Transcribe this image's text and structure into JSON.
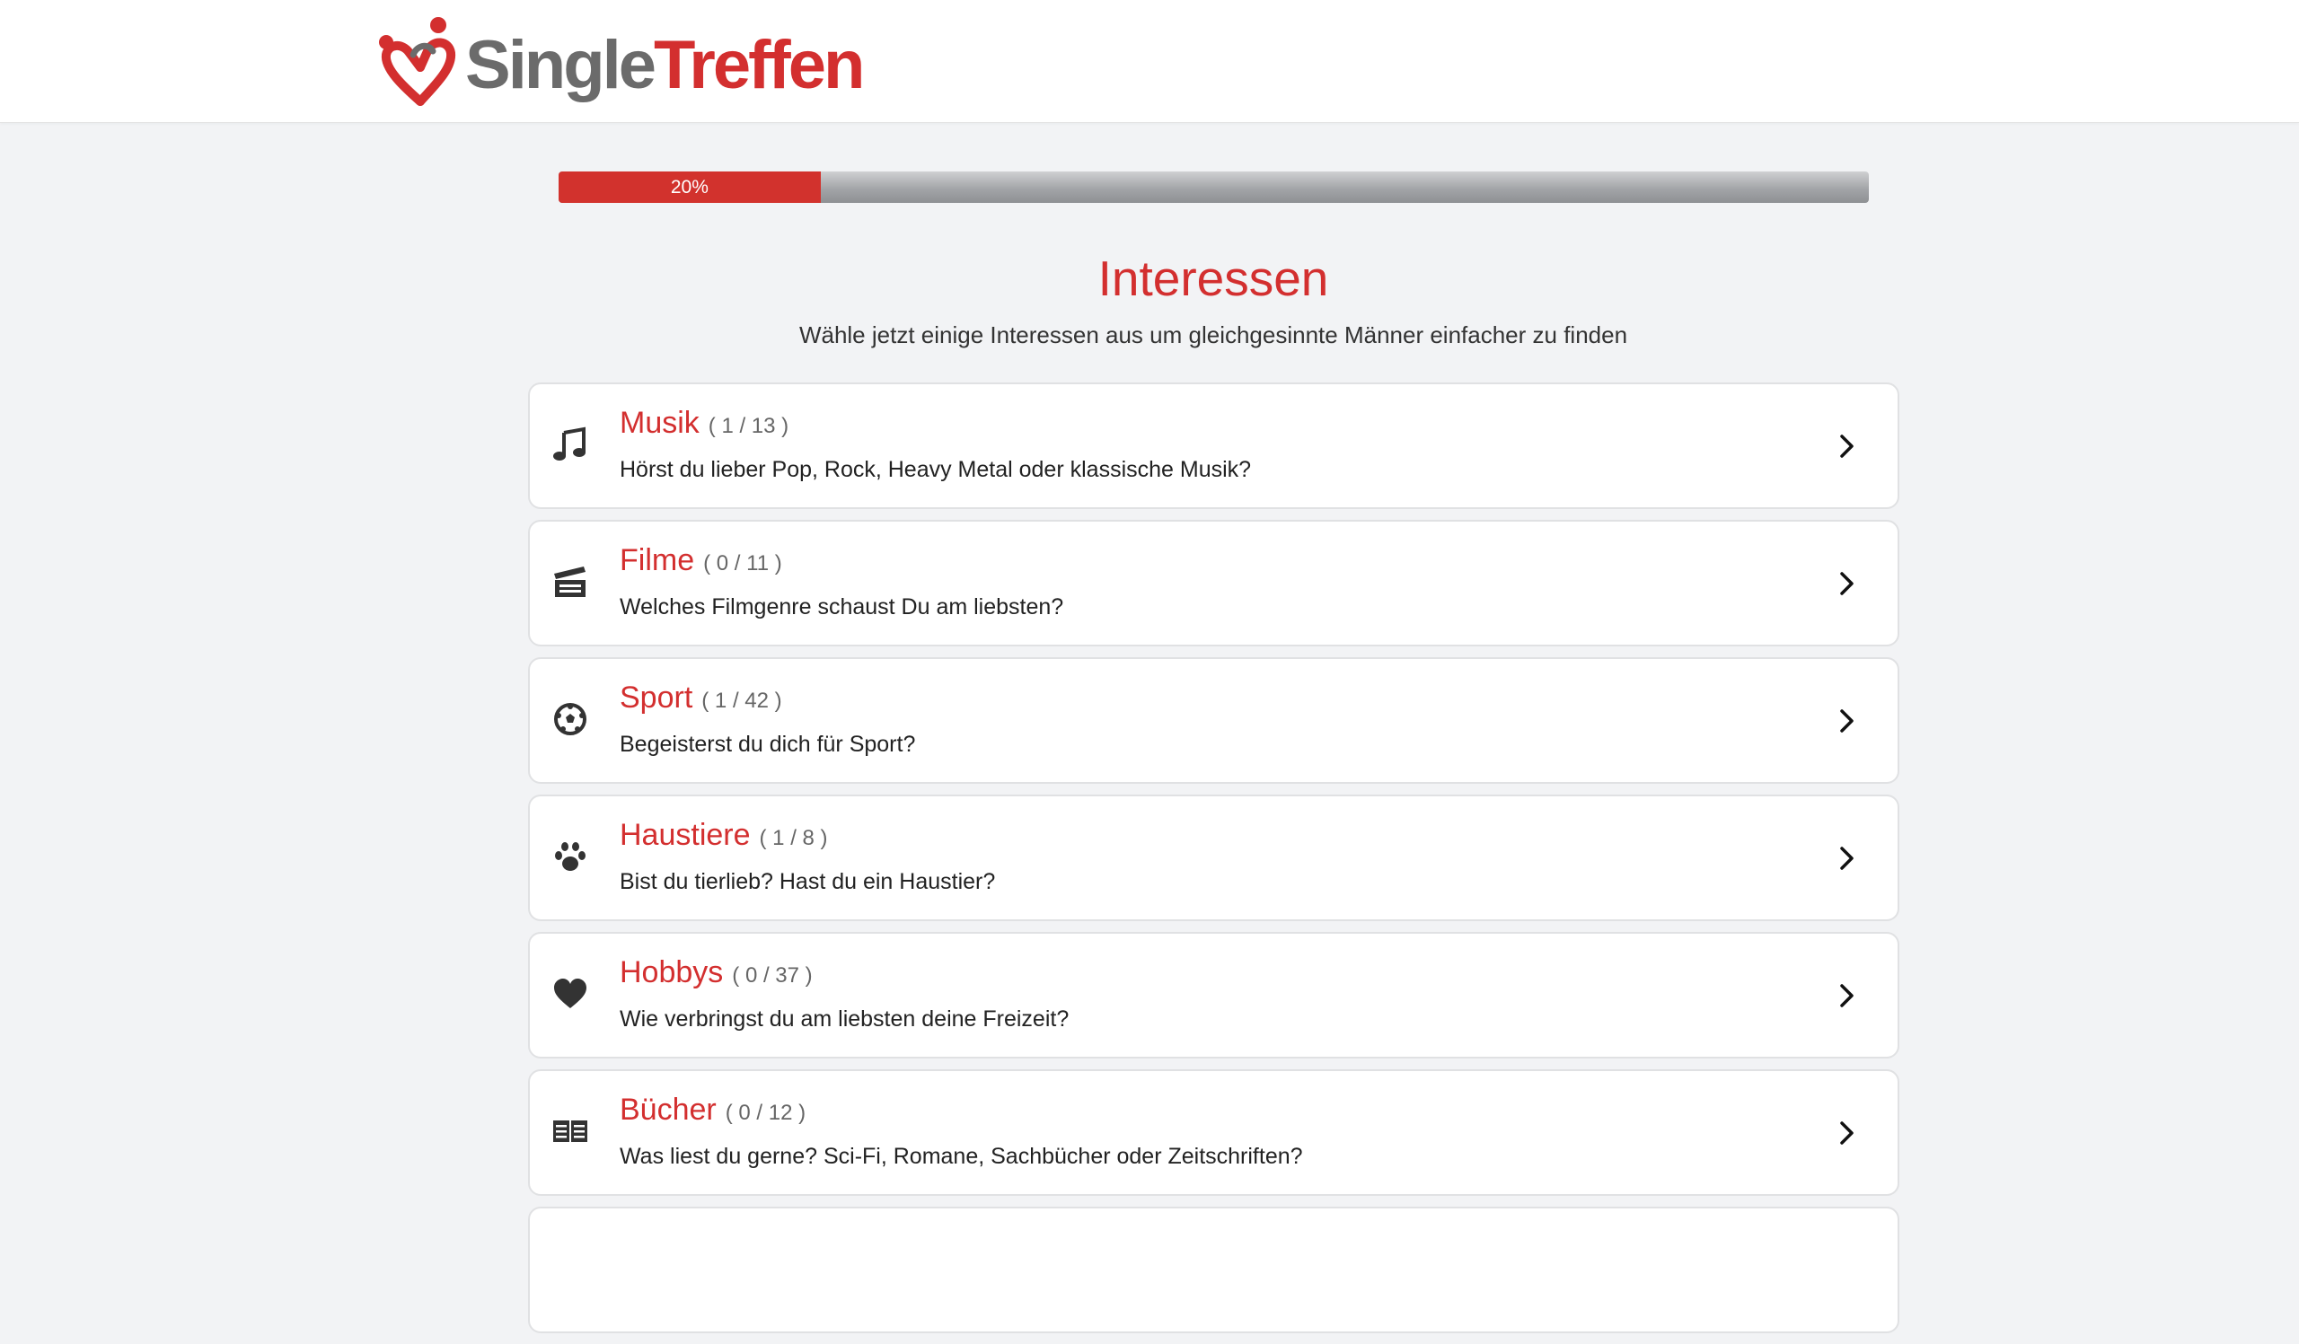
{
  "header": {
    "logo_single": "Single",
    "logo_treffen": "Treffen"
  },
  "progress": {
    "label": "20%",
    "value": 20
  },
  "title": "Interessen",
  "subtitle": "Wähle jetzt einige Interessen aus um gleichgesinnte Männer einfacher zu finden",
  "colors": {
    "brand_red": "#d32f2f",
    "logo_grey": "#6b6b6b",
    "background": "#f2f3f5"
  },
  "categories": [
    {
      "icon": "music-note-icon",
      "name": "Musik",
      "count": "( 1 / 13 )",
      "description": "Hörst du lieber Pop, Rock, Heavy Metal oder klassische Musik?"
    },
    {
      "icon": "clapperboard-icon",
      "name": "Filme",
      "count": "( 0 / 11 )",
      "description": "Welches Filmgenre schaust Du am liebsten?"
    },
    {
      "icon": "soccer-ball-icon",
      "name": "Sport",
      "count": "( 1 / 42 )",
      "description": "Begeisterst du dich für Sport?"
    },
    {
      "icon": "paw-icon",
      "name": "Haustiere",
      "count": "( 1 / 8 )",
      "description": "Bist du tierlieb? Hast du ein Haustier?"
    },
    {
      "icon": "heart-icon",
      "name": "Hobbys",
      "count": "( 0 / 37 )",
      "description": "Wie verbringst du am liebsten deine Freizeit?"
    },
    {
      "icon": "book-icon",
      "name": "Bücher",
      "count": "( 0 / 12 )",
      "description": "Was liest du gerne? Sci-Fi, Romane, Sachbücher oder Zeitschriften?"
    }
  ]
}
